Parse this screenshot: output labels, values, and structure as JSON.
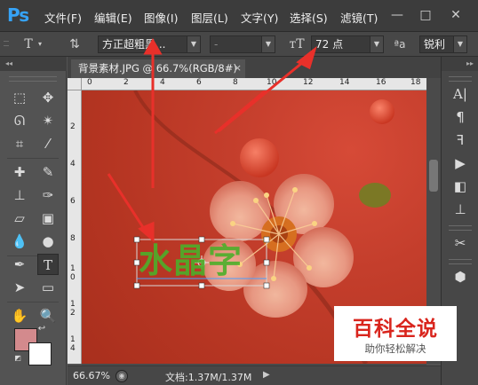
{
  "app": {
    "logo": "Ps"
  },
  "menu": {
    "items": [
      "文件(F)",
      "编辑(E)",
      "图像(I)",
      "图层(L)",
      "文字(Y)",
      "选择(S)",
      "滤镜(T)"
    ],
    "window_buttons": [
      "—",
      "□",
      "✕"
    ]
  },
  "options": {
    "font_family": "方正超粗黑...",
    "font_style": "-",
    "font_size": "72 点",
    "aa_label": "ªa",
    "antialias": "锐利"
  },
  "document": {
    "tab_title": "背景素材.JPG @ 66.7%(RGB/8#)",
    "close": "×",
    "text_layer": "水晶字",
    "ruler_top": [
      "0",
      "2",
      "4",
      "6",
      "8",
      "10",
      "12",
      "14",
      "16",
      "18"
    ],
    "ruler_left": [
      "2",
      "4",
      "6",
      "8",
      "1",
      "0",
      "1",
      "2",
      "1",
      "4"
    ]
  },
  "status": {
    "zoom": "66.67%",
    "doc_info": "文档:1.37M/1.37M",
    "arrow": "▶"
  },
  "watermark": {
    "title": "百科全说",
    "subtitle": "助你轻松解决"
  },
  "colors": {
    "foreground": "#d38a8d",
    "background": "#ffffff",
    "canvas": "#c43e2c",
    "annotation_arrow": "#e8302a",
    "text_layer_fill": "#4caf2a"
  },
  "tools": [
    "move-tool",
    "marquee-tool",
    "lasso-tool",
    "magic-wand-tool",
    "crop-tool",
    "eyedropper-tool",
    "healing-brush-tool",
    "brush-tool",
    "clone-stamp-tool",
    "history-brush-tool",
    "eraser-tool",
    "gradient-tool",
    "blur-tool",
    "dodge-tool",
    "pen-tool",
    "type-tool",
    "path-selection-tool",
    "rectangle-tool",
    "hand-tool",
    "zoom-tool"
  ]
}
